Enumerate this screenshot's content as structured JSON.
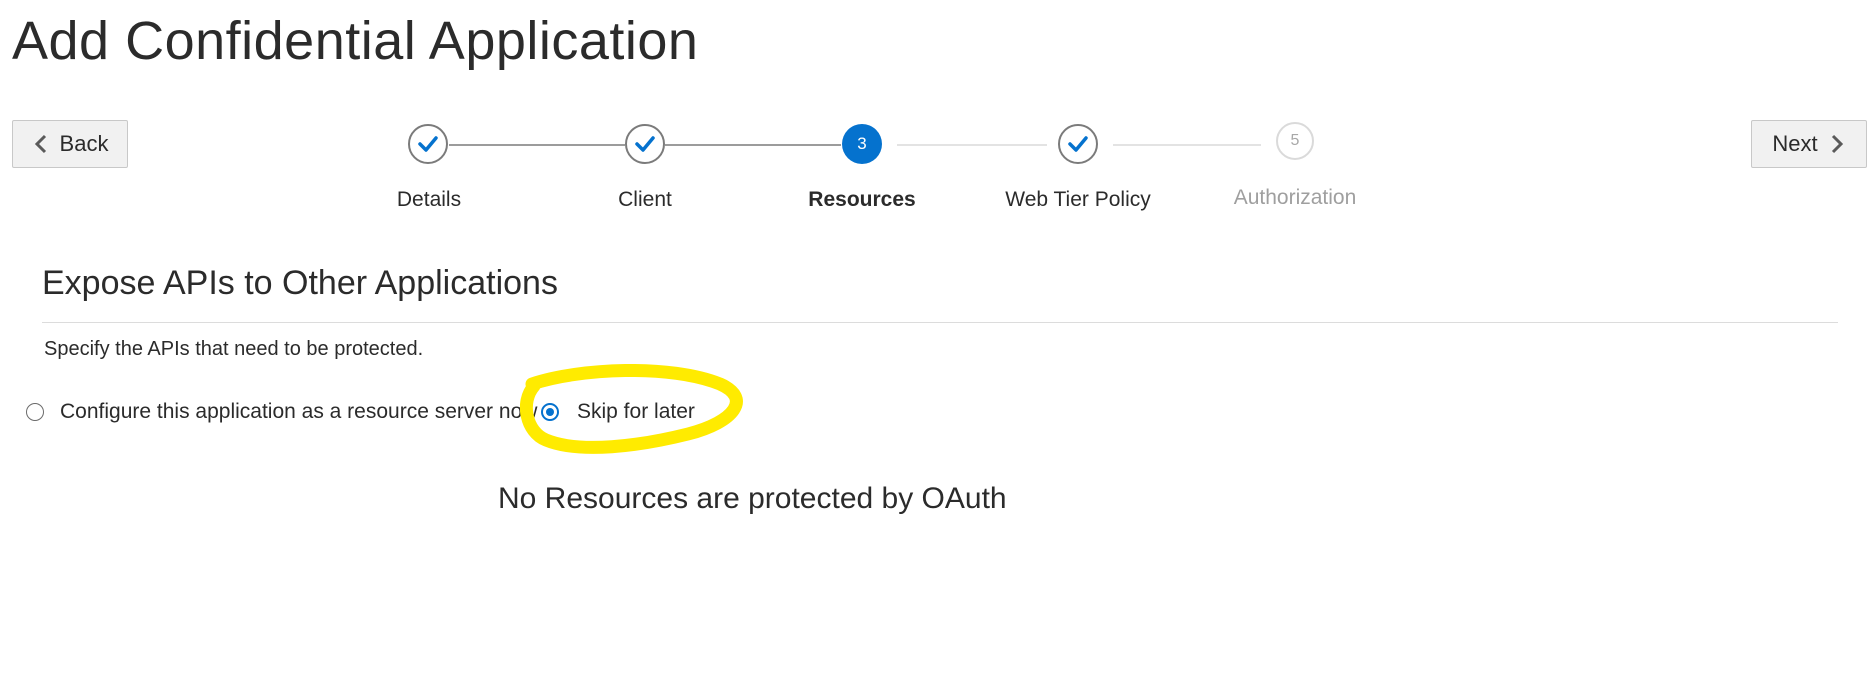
{
  "page": {
    "title": "Add Confidential Application"
  },
  "navigation": {
    "back_label": "Back",
    "next_label": "Next"
  },
  "train": {
    "steps": [
      {
        "label": "Details",
        "state": "visited"
      },
      {
        "label": "Client",
        "state": "visited"
      },
      {
        "label": "Resources",
        "state": "current",
        "number": "3"
      },
      {
        "label": "Web Tier Policy",
        "state": "visited"
      },
      {
        "label": "Authorization",
        "state": "future",
        "number": "5"
      }
    ]
  },
  "section": {
    "title": "Expose APIs to Other Applications",
    "instructions": "Specify the APIs that need to be protected."
  },
  "options": {
    "configure_label": "Configure this application as a resource server now",
    "skip_label": "Skip for later",
    "selected": "skip"
  },
  "empty_state": {
    "message": "No Resources are protected by OAuth"
  },
  "colors": {
    "accent": "#0572ce",
    "highlight": "#ffeb00"
  }
}
